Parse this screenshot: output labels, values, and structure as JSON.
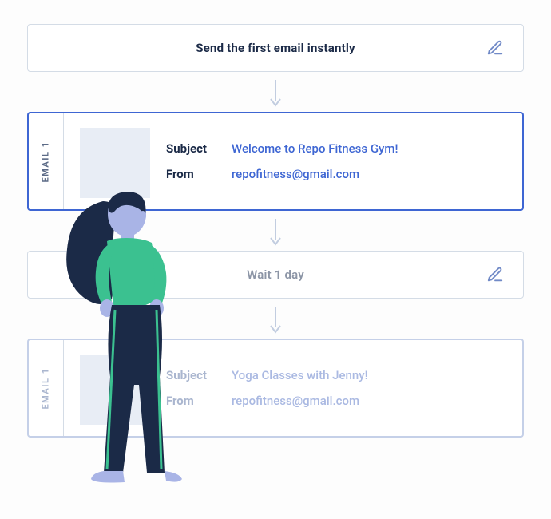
{
  "steps": {
    "send_first": {
      "label": "Send the first email instantly"
    },
    "wait": {
      "label": "Wait 1 day"
    }
  },
  "emails": [
    {
      "side_label": "EMAIL 1",
      "subject_label": "Subject",
      "subject_value": "Welcome to Repo Fitness Gym!",
      "from_label": "From",
      "from_value": "repofitness@gmail.com"
    },
    {
      "side_label": "EMAIL 1",
      "subject_label": "Subject",
      "subject_value": "Yoga Classes with Jenny!",
      "from_label": "From",
      "from_value": "repofitness@gmail.com"
    }
  ]
}
